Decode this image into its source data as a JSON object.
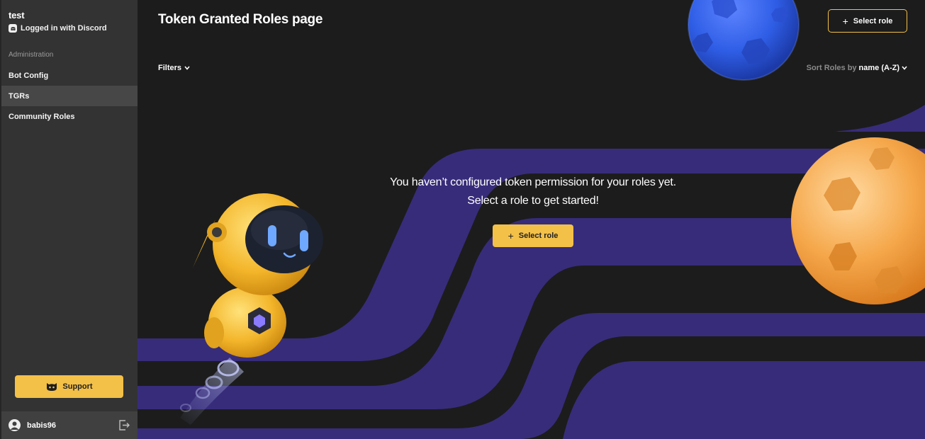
{
  "sidebar": {
    "server_name": "test",
    "login_status": "Logged in with Discord",
    "section_label": "Administration",
    "items": [
      {
        "label": "Bot Config",
        "active": false
      },
      {
        "label": "TGRs",
        "active": true
      },
      {
        "label": "Community Roles",
        "active": false
      }
    ],
    "support_label": "Support",
    "username": "babis96"
  },
  "header": {
    "title": "Token Granted Roles page",
    "select_role_label": "Select role"
  },
  "toolbar": {
    "filters_label": "Filters",
    "sort_prefix": "Sort Roles by",
    "sort_value": "name (A-Z)"
  },
  "empty_state": {
    "line1": "You haven’t configured token permission for your roles yet.",
    "line2": "Select a role to get started!",
    "button_label": "Select role"
  },
  "colors": {
    "accent": "#f3c048",
    "stripe": "#372c7a",
    "background": "#1c1c1c",
    "sidebar": "#333333"
  },
  "icons": {
    "plus": "+",
    "filters_chevron": "chevron-down-icon",
    "sort_chevron": "chevron-down-icon"
  }
}
